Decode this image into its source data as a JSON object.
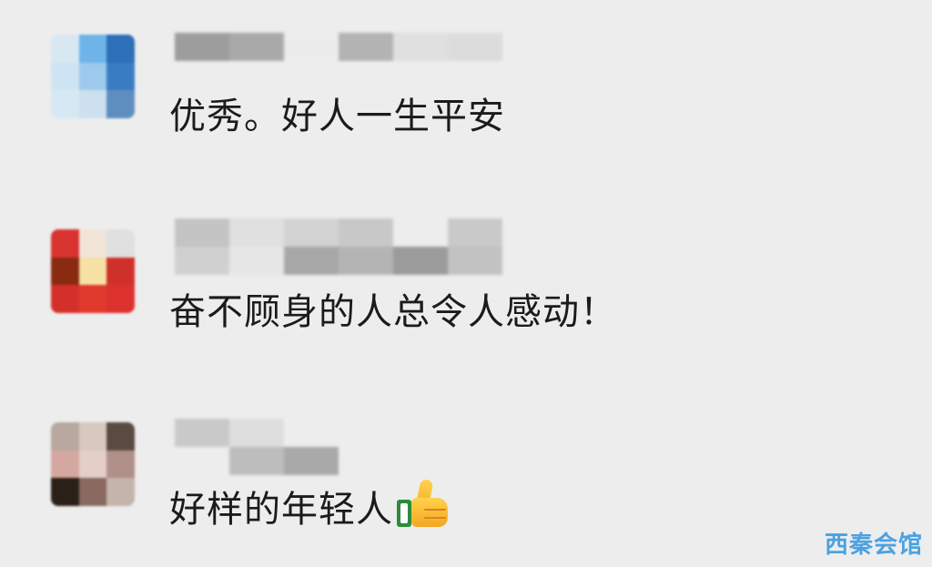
{
  "comments": [
    {
      "text": "优秀。好人一生平安",
      "avatar_colors": [
        "#d8e8f2",
        "#6eb4e8",
        "#2d6fb8",
        "#cfe4f2",
        "#9cc9ec",
        "#3a7cc3",
        "#d6e8f3",
        "#cde0ee",
        "#5e8ec0"
      ],
      "name_colors": [
        "#9d9d9d",
        "#a9a9a9",
        "#ececec",
        "#b3b3b3",
        "#e0e0e0",
        "#dcdcdc",
        "#ededed",
        "#ededed",
        "#ededed",
        "#ededed",
        "#ededed",
        "#ededed"
      ]
    },
    {
      "text": "奋不顾身的人总令人感动！",
      "avatar_colors": [
        "#d93330",
        "#f1e4d8",
        "#e0e0e0",
        "#8a2a10",
        "#f7e1a4",
        "#d0302c",
        "#d4302b",
        "#e03a2c",
        "#dc322d"
      ],
      "name_colors": [
        "#c4c4c4",
        "#e0e0e0",
        "#d3d3d3",
        "#c8c8c8",
        "#ededed",
        "#c9c9c9",
        "#d0d0d0",
        "#e6e6e6",
        "#a8a8a8",
        "#b4b4b4",
        "#9b9b9b",
        "#c2c2c2"
      ]
    },
    {
      "text": "好样的年轻人",
      "emoji": "thumbs-up",
      "avatar_colors": [
        "#b8a8a0",
        "#d8c8c0",
        "#5a4a42",
        "#d4a8a0",
        "#e3cfc8",
        "#b09088",
        "#2a2018",
        "#8a6a60",
        "#c4b4ac"
      ],
      "name_colors": [
        "#c9c9c9",
        "#dedede",
        "#ededed",
        "#ededed",
        "#ededed",
        "#ededed",
        "#ededed",
        "#bdbdbd",
        "#a9a9a9",
        "#ededed",
        "#ededed",
        "#ededed"
      ]
    }
  ],
  "watermark": "西秦会馆",
  "colors": {
    "background": "#ededed",
    "text": "#1b1b1b",
    "watermark": "#3a9ae0"
  }
}
